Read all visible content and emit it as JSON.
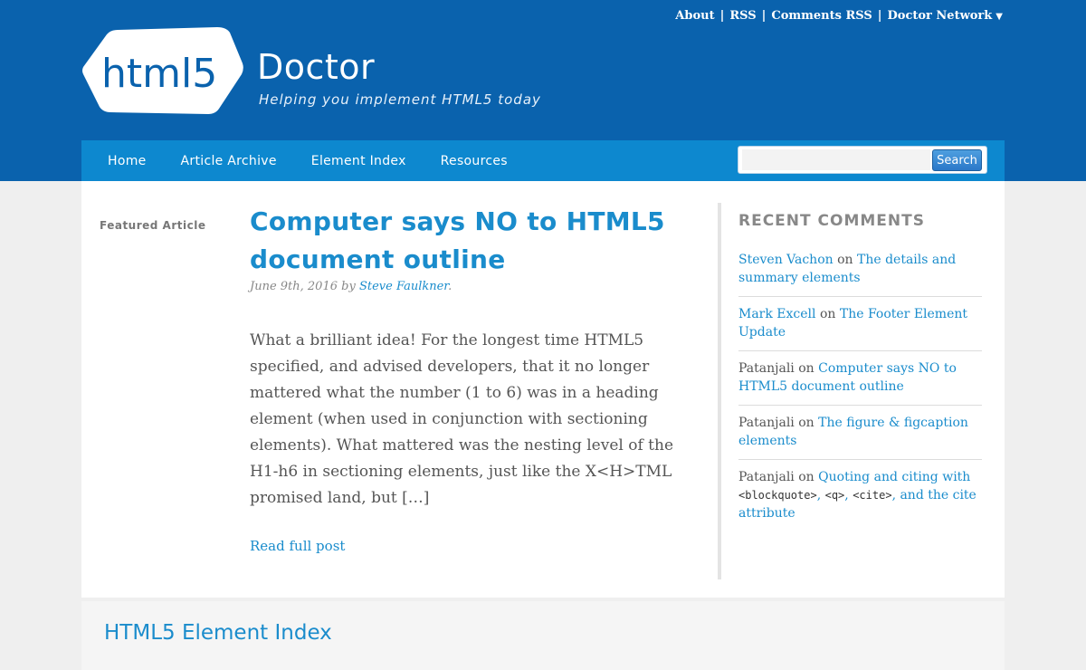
{
  "top_links": {
    "about": "About",
    "rss": "RSS",
    "comments_rss": "Comments RSS",
    "doctor_network": "Doctor Network",
    "separator": "|"
  },
  "brand": {
    "logo_text": "html5",
    "name": "Doctor",
    "tagline": "Helping you implement HTML5 today"
  },
  "nav": {
    "items": [
      "Home",
      "Article Archive",
      "Element Index",
      "Resources"
    ],
    "search_placeholder": "",
    "search_button": "Search"
  },
  "featured": {
    "label": "Featured Article",
    "title": "Computer says NO to HTML5 document outline",
    "date": "June 9th, 2016",
    "by": "by",
    "author": "Steve Faulkner",
    "excerpt": "What a brilliant idea! For the longest time HTML5 specified, and advised developers, that it no longer mattered what the number (1 to 6) was in a heading element (when used in conjunction with sectioning elements). What mattered was the nesting level of the H1-h6 in sectioning elements, just like the X<H>TML promised land, but […]",
    "read_more": "Read full post"
  },
  "recent_comments": {
    "title": "RECENT COMMENTS",
    "on": "on",
    "items": [
      {
        "author": "Steven Vachon",
        "author_linked": true,
        "post": "The details and summary elements"
      },
      {
        "author": "Mark Excell",
        "author_linked": true,
        "post": "The Footer Element Update"
      },
      {
        "author": "Patanjali",
        "author_linked": false,
        "post": "Computer says NO to HTML5 document outline"
      },
      {
        "author": "Patanjali",
        "author_linked": false,
        "post": "The figure & figcaption elements"
      },
      {
        "author": "Patanjali",
        "author_linked": false,
        "post_parts": [
          "Quoting and citing with ",
          "<blockquote>",
          ", ",
          "<q>",
          ", ",
          "<cite>",
          ", and the cite attribute"
        ]
      }
    ]
  },
  "element_index": {
    "title": "HTML5 Element Index"
  },
  "colors": {
    "header_blue": "#0a62ad",
    "nav_blue": "#0d88cf",
    "link_blue": "#1a8ccc"
  }
}
